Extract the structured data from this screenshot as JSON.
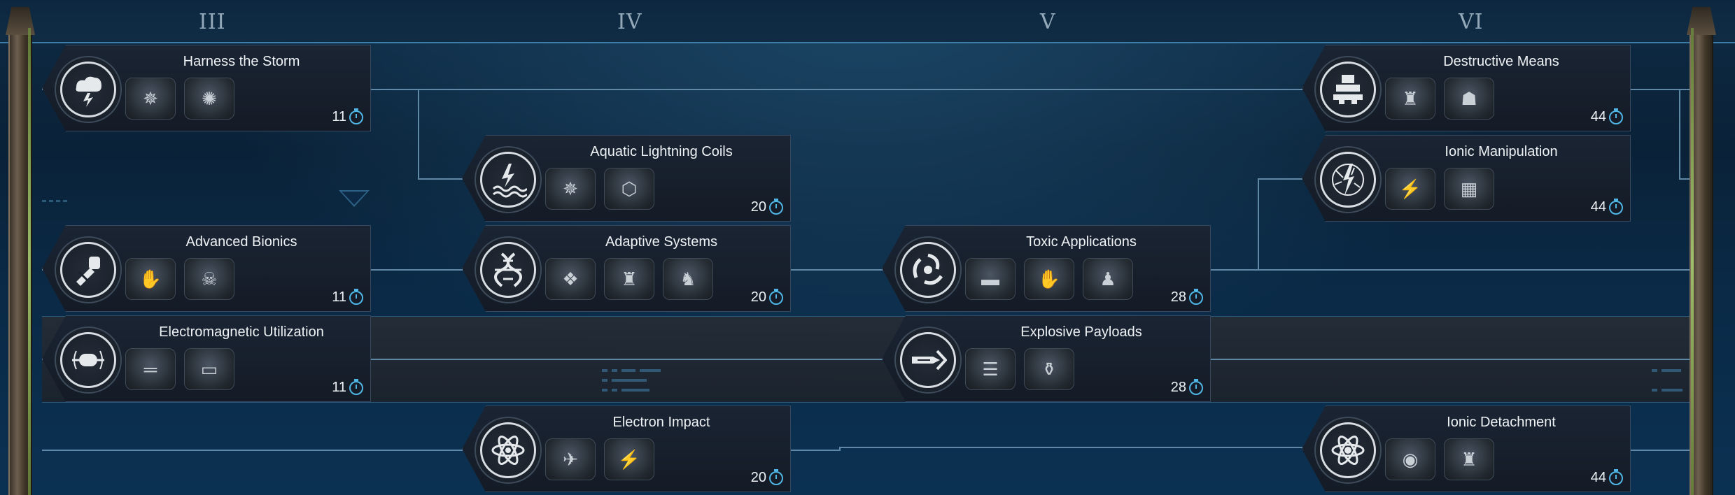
{
  "tiers": [
    "III",
    "IV",
    "V",
    "VI"
  ],
  "nodes": [
    {
      "title": "Harness the Storm",
      "cost": "11",
      "emblem": "storm-cloud-lightning-icon",
      "thumbs": [
        "unit-swarm-thumb",
        "spider-walker-thumb"
      ]
    },
    {
      "title": "Aquatic Lightning Coils",
      "cost": "20",
      "emblem": "lightning-over-waves-icon",
      "thumbs": [
        "unit-swarm-thumb",
        "lion-badge-thumb"
      ]
    },
    {
      "title": "Advanced Bionics",
      "cost": "11",
      "emblem": "robotic-arm-icon",
      "thumbs": [
        "bionic-arm-thumb",
        "skull-burst-thumb"
      ]
    },
    {
      "title": "Adaptive Systems",
      "cost": "20",
      "emblem": "dna-helix-icon",
      "thumbs": [
        "creature-thumb",
        "armor-figure-thumb",
        "mask-figure-thumb"
      ]
    },
    {
      "title": "Toxic Applications",
      "cost": "28",
      "emblem": "biohazard-swirl-icon",
      "thumbs": [
        "canister-thumb",
        "arm-thumb",
        "crowd-thumb"
      ]
    },
    {
      "title": "Electromagnetic Utilization",
      "cost": "11",
      "emblem": "coil-capsule-icon",
      "thumbs": [
        "rifle-thumb",
        "cannon-thumb"
      ]
    },
    {
      "title": "Explosive Payloads",
      "cost": "28",
      "emblem": "missile-icon",
      "thumbs": [
        "ammo-thumb",
        "bombs-thumb"
      ]
    },
    {
      "title": "Electron Impact",
      "cost": "20",
      "emblem": "atom-lightning-icon",
      "thumbs": [
        "ship-thumb",
        "soldier-thumb"
      ]
    },
    {
      "title": "Destructive Means",
      "cost": "44",
      "emblem": "fortress-icon",
      "thumbs": [
        "mech-thumb",
        "creature-head-thumb"
      ]
    },
    {
      "title": "Ionic Manipulation",
      "cost": "44",
      "emblem": "lightning-globe-icon",
      "thumbs": [
        "circuit-thumb",
        "circuit-thumb"
      ]
    },
    {
      "title": "Ionic Detachment",
      "cost": "44",
      "emblem": "atom-icon",
      "thumbs": [
        "drone-thumb",
        "robot-thumb"
      ]
    }
  ]
}
